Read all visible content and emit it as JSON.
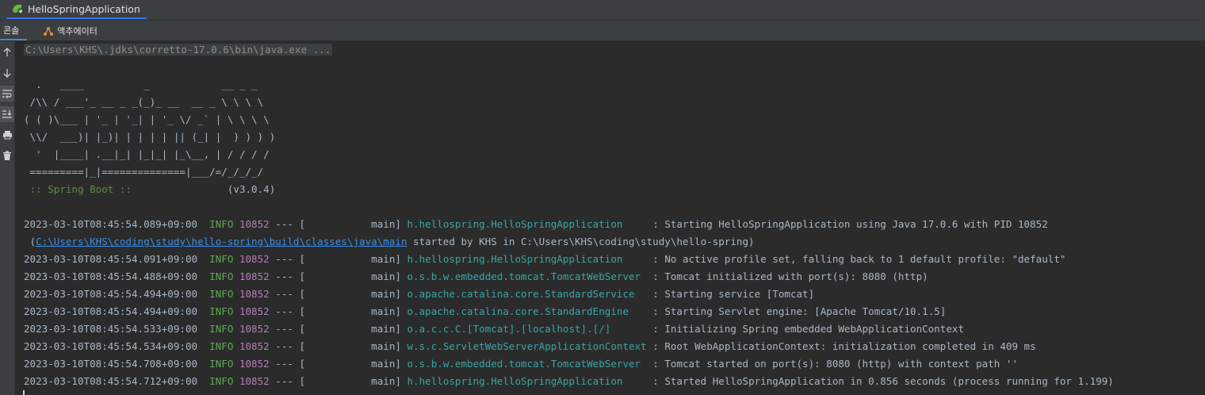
{
  "window": {
    "run_tab_label": "HelloSpringApplication"
  },
  "subtabs": {
    "console": "콘솔",
    "actuator": "액추에이터"
  },
  "sidebar_icons": [
    "arrow-up-icon",
    "arrow-down-icon",
    "soft-wrap-icon",
    "scroll-to-end-icon",
    "print-icon",
    "trash-icon"
  ],
  "console": {
    "command": "C:\\Users\\KHS\\.jdks\\corretto-17.0.6\\bin\\java.exe ...",
    "banner": [
      "  .   ____          _            __ _ _",
      " /\\\\ / ___'_ __ _ _(_)_ __  __ _ \\ \\ \\ \\",
      "( ( )\\___ | '_ | '_| | '_ \\/ _` | \\ \\ \\ \\",
      " \\\\/  ___)| |_)| | | | | || (_| |  ) ) ) )",
      "  '  |____| .__|_| |_|_| |_\\__, | / / / /",
      " =========|_|==============|___/=/_/_/_/"
    ],
    "boot_label": " :: Spring Boot ::",
    "boot_version": "                (v3.0.4)",
    "log": [
      {
        "ts": "2023-03-10T08:45:54.089+09:00",
        "level": "INFO",
        "pid": "10852",
        "thread": "--- [           main]",
        "logger": "h.hellospring.HelloSpringApplication    ",
        "msg": " : Starting HelloSpringApplication using Java 17.0.6 with PID 10852"
      },
      {
        "ts": "2023-03-10T08:45:54.091+09:00",
        "level": "INFO",
        "pid": "10852",
        "thread": "--- [           main]",
        "logger": "h.hellospring.HelloSpringApplication    ",
        "msg": " : No active profile set, falling back to 1 default profile: \"default\""
      },
      {
        "ts": "2023-03-10T08:45:54.488+09:00",
        "level": "INFO",
        "pid": "10852",
        "thread": "--- [           main]",
        "logger": "o.s.b.w.embedded.tomcat.TomcatWebServer ",
        "msg": " : Tomcat initialized with port(s): 8080 (http)"
      },
      {
        "ts": "2023-03-10T08:45:54.494+09:00",
        "level": "INFO",
        "pid": "10852",
        "thread": "--- [           main]",
        "logger": "o.apache.catalina.core.StandardService  ",
        "msg": " : Starting service [Tomcat]"
      },
      {
        "ts": "2023-03-10T08:45:54.494+09:00",
        "level": "INFO",
        "pid": "10852",
        "thread": "--- [           main]",
        "logger": "o.apache.catalina.core.StandardEngine   ",
        "msg": " : Starting Servlet engine: [Apache Tomcat/10.1.5]"
      },
      {
        "ts": "2023-03-10T08:45:54.533+09:00",
        "level": "INFO",
        "pid": "10852",
        "thread": "--- [           main]",
        "logger": "o.a.c.c.C.[Tomcat].[localhost].[/]      ",
        "msg": " : Initializing Spring embedded WebApplicationContext"
      },
      {
        "ts": "2023-03-10T08:45:54.534+09:00",
        "level": "INFO",
        "pid": "10852",
        "thread": "--- [           main]",
        "logger": "w.s.c.ServletWebServerApplicationContext",
        "msg": " : Root WebApplicationContext: initialization completed in 409 ms"
      },
      {
        "ts": "2023-03-10T08:45:54.708+09:00",
        "level": "INFO",
        "pid": "10852",
        "thread": "--- [           main]",
        "logger": "o.s.b.w.embedded.tomcat.TomcatWebServer ",
        "msg": " : Tomcat started on port(s): 8080 (http) with context path ''"
      },
      {
        "ts": "2023-03-10T08:45:54.712+09:00",
        "level": "INFO",
        "pid": "10852",
        "thread": "--- [           main]",
        "logger": "h.hellospring.HelloSpringApplication    ",
        "msg": " : Started HelloSpringApplication in 0.856 seconds (process running for 1.199)"
      }
    ],
    "cont_open": " (",
    "cont_link": "C:\\Users\\KHS\\coding\\study\\hello-spring\\build\\classes\\java\\main",
    "cont_rest": " started by KHS in C:\\Users\\KHS\\coding\\study\\hello-spring)"
  },
  "colors": {
    "info": "#5fa856",
    "pid": "#b47eb8",
    "logger": "#3aa5a5",
    "link": "#3d8fe8",
    "background": "#2b2b2b"
  }
}
